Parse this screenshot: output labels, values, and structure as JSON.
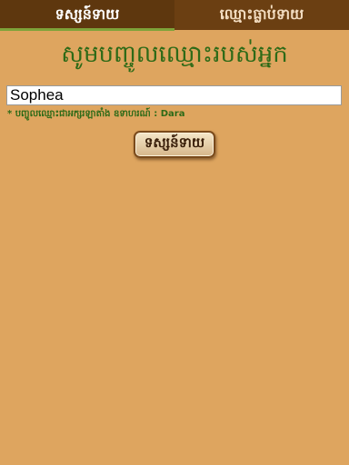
{
  "tabs": [
    {
      "label": "ទស្សន៍ទាយ",
      "active": true
    },
    {
      "label": "ឈ្មោះធ្លាប់ទាយ",
      "active": false
    }
  ],
  "heading": "សូមបញ្ចូលឈ្មោះរបស់អ្នក",
  "name_input": {
    "value": "Sophea"
  },
  "hint": "* បញ្ចូលឈ្មោះជាអក្សរឡាតាំង ឧទាហរណ៍ : Dara",
  "start_button_label": "ទស្សន៍ទាយ",
  "colors": {
    "background": "#dea55f",
    "tab_bar": "#6b3f12",
    "tab_indicator": "#7ea33a",
    "heading": "#2d6a17"
  }
}
